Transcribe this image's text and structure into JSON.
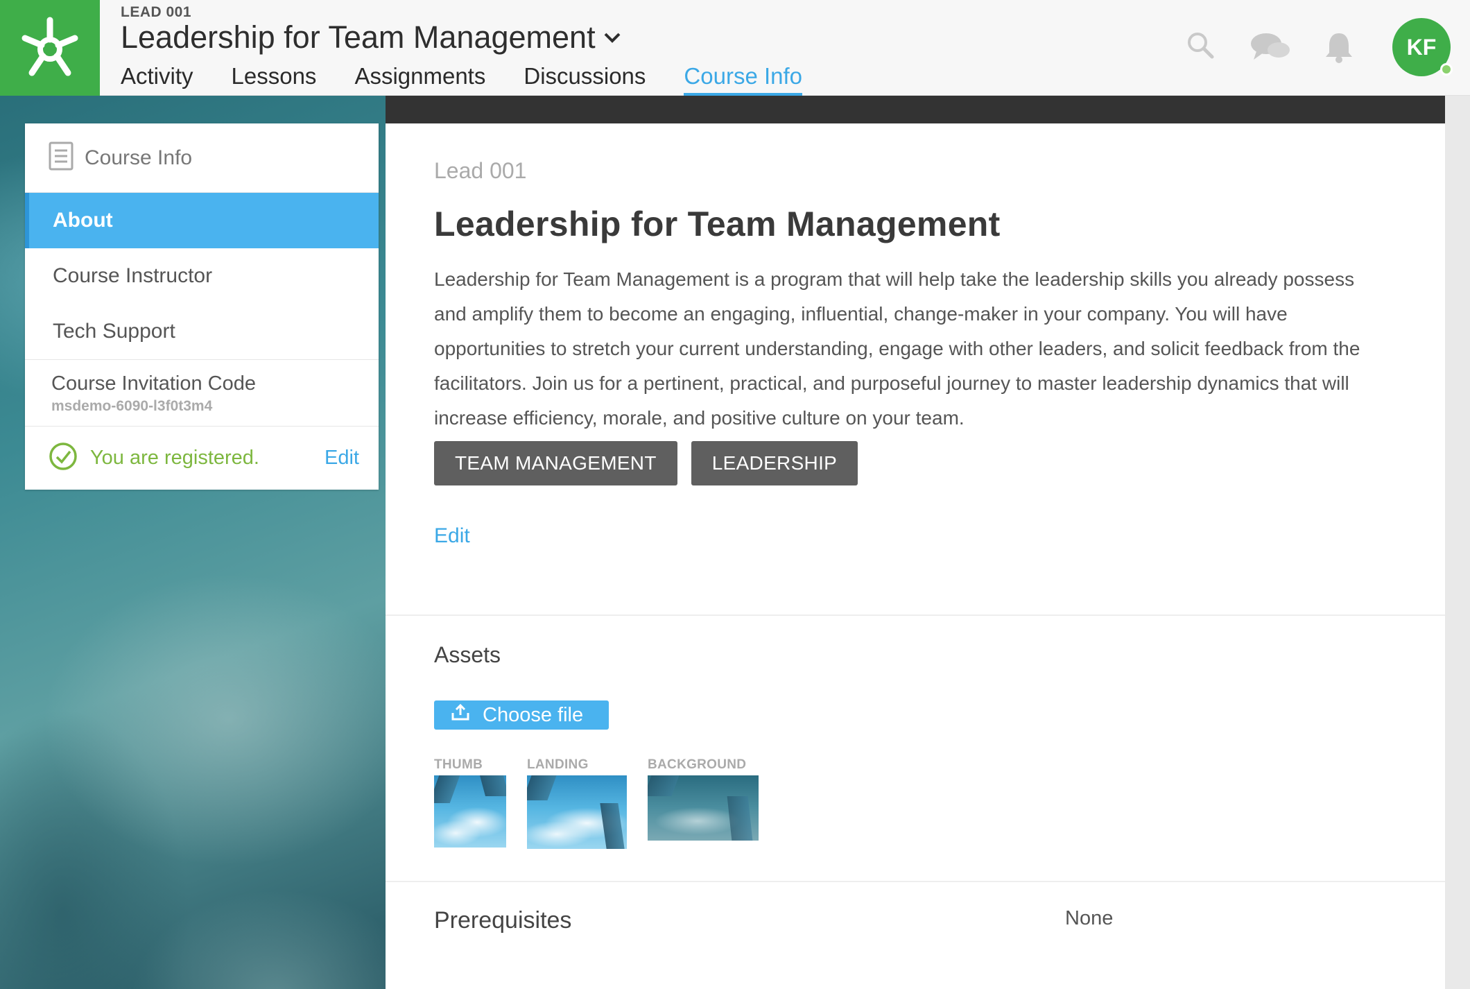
{
  "header": {
    "course_code": "LEAD 001",
    "course_title": "Leadership for Team Management",
    "tabs": [
      {
        "label": "Activity",
        "active": false
      },
      {
        "label": "Lessons",
        "active": false
      },
      {
        "label": "Assignments",
        "active": false
      },
      {
        "label": "Discussions",
        "active": false
      },
      {
        "label": "Course Info",
        "active": true
      }
    ],
    "icons": [
      "search-icon",
      "chat-icon",
      "bell-icon"
    ],
    "avatar_initials": "KF",
    "colors": {
      "brand_green": "#3fae49",
      "accent_blue": "#3ba8e6",
      "presence_green": "#8bd16d"
    }
  },
  "sidebar": {
    "header_label": "Course Info",
    "items": [
      {
        "label": "About",
        "active": true
      },
      {
        "label": "Course Instructor",
        "active": false
      },
      {
        "label": "Tech Support",
        "active": false
      }
    ],
    "invitation_label": "Course Invitation Code",
    "invitation_code": "msdemo-6090-l3f0t3m4",
    "registered_text": "You are registered.",
    "registered_edit": "Edit"
  },
  "main": {
    "course_code": "Lead 001",
    "title": "Leadership for Team Management",
    "description": "Leadership for Team Management is a program that will help take the leadership skills you already possess and amplify them to become an engaging, influential, change-maker in your company. You will have opportunities to stretch your current understanding, engage with other leaders, and solicit feedback from the facilitators. Join us for a pertinent, practical, and purposeful journey to master leadership dynamics that will increase efficiency, morale, and positive culture on your team.",
    "tags": [
      "TEAM MANAGEMENT",
      "LEADERSHIP"
    ],
    "edit_label": "Edit",
    "assets": {
      "heading": "Assets",
      "choose_file_label": "Choose file",
      "images": [
        {
          "label": "THUMB"
        },
        {
          "label": "LANDING"
        },
        {
          "label": "BACKGROUND"
        }
      ]
    },
    "prerequisites": {
      "label": "Prerequisites",
      "value": "None"
    }
  }
}
